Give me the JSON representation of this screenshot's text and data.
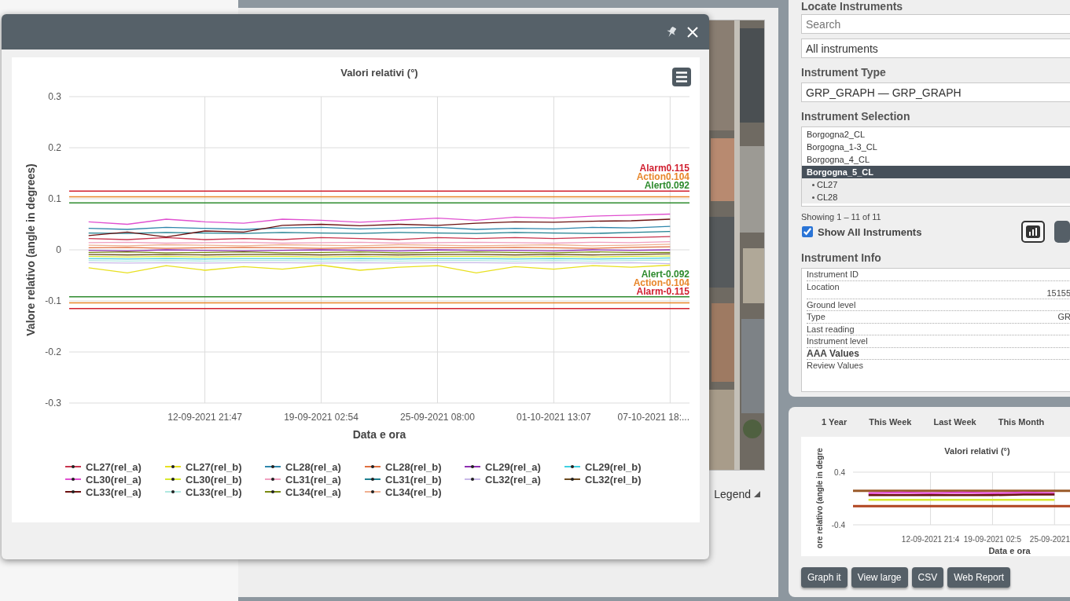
{
  "map_panel": {
    "legend_label": "Legend"
  },
  "chart_window": {
    "chart_data": {
      "type": "line",
      "title": "Valori relativi (°)",
      "xlabel": "Data e ora",
      "ylabel": "Valore relativo (angle in degrees)",
      "categories": [
        null,
        null,
        null,
        "12-09-2021 21:47",
        null,
        null,
        "19-09-2021 02:54",
        null,
        null,
        "25-09-2021 08:00",
        null,
        null,
        "01-10-2021 13:07",
        null,
        null,
        "07-10-2021 18:..."
      ],
      "ylim": [
        -0.3,
        0.3
      ],
      "grid": true,
      "legend": "bottom",
      "yticks": [
        {
          "value": 0.3,
          "label": "0.3"
        },
        {
          "value": 0.2,
          "label": "0.2"
        },
        {
          "value": 0.1,
          "label": "0.1"
        },
        {
          "value": 0,
          "label": "0"
        },
        {
          "value": -0.1,
          "label": "-0.1"
        },
        {
          "value": -0.2,
          "label": "-0.2"
        },
        {
          "value": -0.3,
          "label": "-0.3"
        }
      ],
      "series": [
        {
          "name": "CL27(rel_a)",
          "color": "#c8354e",
          "values": [
            0.022,
            0.02,
            0.024,
            0.02,
            0.022,
            0.02,
            0.024,
            0.022,
            0.02,
            0.024,
            0.022,
            0.024,
            0.022,
            0.024,
            0.024,
            0.026
          ]
        },
        {
          "name": "CL27(rel_b)",
          "color": "#e8e020",
          "values": [
            -0.035,
            -0.045,
            -0.031,
            -0.04,
            -0.033,
            -0.038,
            -0.03,
            -0.04,
            -0.034,
            -0.031,
            -0.045,
            -0.033,
            -0.038,
            -0.031,
            -0.034,
            -0.03
          ]
        },
        {
          "name": "CL28(rel_a)",
          "color": "#2e86ab",
          "values": [
            0.042,
            0.04,
            0.044,
            0.042,
            0.04,
            0.043,
            0.044,
            0.041,
            0.043,
            0.044,
            0.04,
            0.042,
            0.041,
            0.044,
            0.043,
            0.046
          ]
        },
        {
          "name": "CL28(rel_b)",
          "color": "#e07040",
          "values": [
            0.004,
            0.005,
            0.003,
            0.004,
            0.005,
            0.004,
            0.003,
            0.004,
            0.005,
            0.004,
            0.004,
            0.005,
            0.004,
            0.003,
            0.005,
            0.006
          ]
        },
        {
          "name": "CL29(rel_a)",
          "color": "#8e2fb0",
          "values": [
            -0.001,
            -0.002,
            0,
            -0.001,
            -0.002,
            -0.001,
            0,
            -0.001,
            -0.002,
            0,
            -0.001,
            -0.001,
            -0.002,
            0,
            -0.001,
            0
          ]
        },
        {
          "name": "CL29(rel_b)",
          "color": "#40d0e0",
          "values": [
            -0.017,
            -0.018,
            -0.017,
            -0.018,
            -0.017,
            -0.017,
            -0.018,
            -0.017,
            -0.018,
            -0.017,
            -0.017,
            -0.018,
            -0.017,
            -0.018,
            -0.017,
            -0.016
          ]
        },
        {
          "name": "CL30(rel_a)",
          "color": "#e050d0",
          "values": [
            0.055,
            0.05,
            0.06,
            0.055,
            0.052,
            0.06,
            0.058,
            0.054,
            0.058,
            0.062,
            0.058,
            0.064,
            0.062,
            0.066,
            0.068,
            0.07
          ]
        },
        {
          "name": "CL30(rel_b)",
          "color": "#d8e830",
          "values": [
            -0.013,
            -0.014,
            -0.013,
            -0.014,
            -0.013,
            -0.013,
            -0.014,
            -0.013,
            -0.014,
            -0.013,
            -0.013,
            -0.014,
            -0.013,
            -0.014,
            -0.013,
            -0.012
          ]
        },
        {
          "name": "CL31(rel_a)",
          "color": "#f0a0c0",
          "values": [
            0.014,
            0.015,
            0.013,
            0.014,
            0.015,
            0.013,
            0.014,
            0.015,
            0.013,
            0.014,
            0.015,
            0.014,
            0.013,
            0.015,
            0.014,
            0.016
          ]
        },
        {
          "name": "CL31(rel_b)",
          "color": "#1f7f8f",
          "values": [
            0.033,
            0.032,
            0.034,
            0.033,
            0.032,
            0.034,
            0.033,
            0.032,
            0.034,
            0.033,
            0.032,
            0.034,
            0.033,
            0.032,
            0.034,
            0.036
          ]
        },
        {
          "name": "CL32(rel_a)",
          "color": "#c8b8e8",
          "values": [
            -0.025,
            -0.026,
            -0.025,
            -0.026,
            -0.025,
            -0.025,
            -0.026,
            -0.025,
            -0.026,
            -0.025,
            -0.025,
            -0.026,
            -0.025,
            -0.026,
            -0.025,
            -0.027
          ]
        },
        {
          "name": "CL32(rel_b)",
          "color": "#6b4a20",
          "values": [
            -0.009,
            -0.01,
            -0.009,
            -0.01,
            -0.009,
            -0.009,
            -0.01,
            -0.009,
            -0.01,
            -0.009,
            -0.009,
            -0.01,
            -0.009,
            -0.01,
            -0.009,
            -0.008
          ]
        },
        {
          "name": "CL33(rel_a)",
          "color": "#6b1010",
          "values": [
            0.028,
            0.035,
            0.025,
            0.037,
            0.035,
            0.048,
            0.05,
            0.047,
            0.05,
            0.048,
            0.052,
            0.055,
            0.054,
            0.056,
            0.057,
            0.06
          ]
        },
        {
          "name": "CL33(rel_b)",
          "color": "#b0e8e0",
          "values": [
            -0.021,
            -0.022,
            -0.021,
            -0.022,
            -0.021,
            -0.021,
            -0.022,
            -0.021,
            -0.022,
            -0.021,
            -0.021,
            -0.022,
            -0.021,
            -0.022,
            -0.021,
            -0.02
          ]
        },
        {
          "name": "CL34(rel_a)",
          "color": "#7a8a10",
          "values": [
            -0.005,
            -0.004,
            -0.006,
            -0.005,
            -0.004,
            -0.006,
            -0.005,
            -0.004,
            -0.006,
            -0.005,
            -0.004,
            -0.005,
            -0.006,
            -0.004,
            -0.005,
            -0.005
          ]
        },
        {
          "name": "CL34(rel_b)",
          "color": "#f0b090",
          "values": [
            0.009,
            0.008,
            0.01,
            0.009,
            0.008,
            0.01,
            0.009,
            0.008,
            0.01,
            0.009,
            0.008,
            0.009,
            0.01,
            0.008,
            0.009,
            0.011
          ]
        }
      ],
      "ref_lines": [
        {
          "axis": "y",
          "value": 0.115,
          "label": "Alarm0.115",
          "color": "#d11f2f"
        },
        {
          "axis": "y",
          "value": 0.104,
          "label": "Action0.104",
          "color": "#e8862a"
        },
        {
          "axis": "y",
          "value": 0.092,
          "label": "Alert0.092",
          "color": "#2e8b2e"
        },
        {
          "axis": "y",
          "value": -0.092,
          "label": "Alert-0.092",
          "color": "#2e8b2e"
        },
        {
          "axis": "y",
          "value": -0.104,
          "label": "Action-0.104",
          "color": "#e8862a"
        },
        {
          "axis": "y",
          "value": -0.115,
          "label": "Alarm-0.115",
          "color": "#d11f2f"
        }
      ]
    }
  },
  "instrument_panel": {
    "heading": "Locate Instruments",
    "search": {
      "placeholder": "Search"
    },
    "filter": {
      "value": "All instruments"
    },
    "type_heading": "Instrument Type",
    "type_field": {
      "value": "GRP_GRAPH — GRP_GRAPH"
    },
    "selection_heading": "Instrument Selection",
    "instruments": [
      {
        "label": "Borgogna2_CL",
        "selected": false
      },
      {
        "label": "Borgogna_1-3_CL",
        "selected": false
      },
      {
        "label": "Borgogna_4_CL",
        "selected": false
      },
      {
        "label": "Borgogna_5_CL",
        "selected": true,
        "children": [
          {
            "label": "CL27",
            "selected": false
          },
          {
            "label": "CL28",
            "selected": false
          }
        ]
      }
    ],
    "showing": "Showing 1 – 11 of 11",
    "show_all": {
      "label": "Show All Instruments",
      "checked": true
    },
    "info_heading": "Instrument Info",
    "info_rows": [
      {
        "label": "Instrument ID",
        "kind": "field"
      },
      {
        "label": "Location",
        "value": "15155",
        "kind": "field"
      },
      {
        "label": "Ground level",
        "kind": "field"
      },
      {
        "label": "Type",
        "value": "GR",
        "kind": "field"
      },
      {
        "label": "Last reading",
        "kind": "field"
      },
      {
        "label": "Instrument level",
        "kind": "field"
      },
      {
        "label": "AAA Values",
        "kind": "section"
      },
      {
        "label": "Review Values",
        "kind": "field"
      }
    ]
  },
  "graph_panel": {
    "ranges": [
      "1 Year",
      "This Week",
      "Last Week",
      "This Month"
    ],
    "chart_data": {
      "type": "line",
      "title": "Valori relativi (°)",
      "xlabel": "Data e ora",
      "ylabel": "ore relativo (angle in degre",
      "categories": [
        null,
        null,
        "12-09-2021 21:4",
        null,
        "19-09-2021 02:5",
        null,
        "25-09-2021"
      ],
      "ylim": [
        -0.4,
        0.4
      ],
      "grid": true,
      "yticks": [
        {
          "value": 0.4,
          "label": "0.4"
        },
        {
          "value": -0.4,
          "label": "-0.4"
        }
      ],
      "series": [
        {
          "color": "#e050d0",
          "values": [
            0.08,
            0.09,
            0.08,
            0.09,
            0.08,
            0.09,
            0.08
          ]
        },
        {
          "color": "#6b1010",
          "values": [
            0.05,
            0.05,
            0.05,
            0.05,
            0.05,
            0.06,
            0.06
          ]
        },
        {
          "color": "#d8e830",
          "values": [
            -0.02,
            -0.02,
            -0.02,
            -0.02,
            -0.02,
            -0.02,
            -0.02
          ]
        }
      ],
      "ref_lines": [
        {
          "axis": "y",
          "value": 0.115,
          "color": "#9a5a2a"
        },
        {
          "axis": "y",
          "value": -0.115,
          "color": "#b0451f"
        }
      ]
    },
    "buttons": [
      "Graph it",
      "View large",
      "CSV",
      "Web Report"
    ]
  }
}
